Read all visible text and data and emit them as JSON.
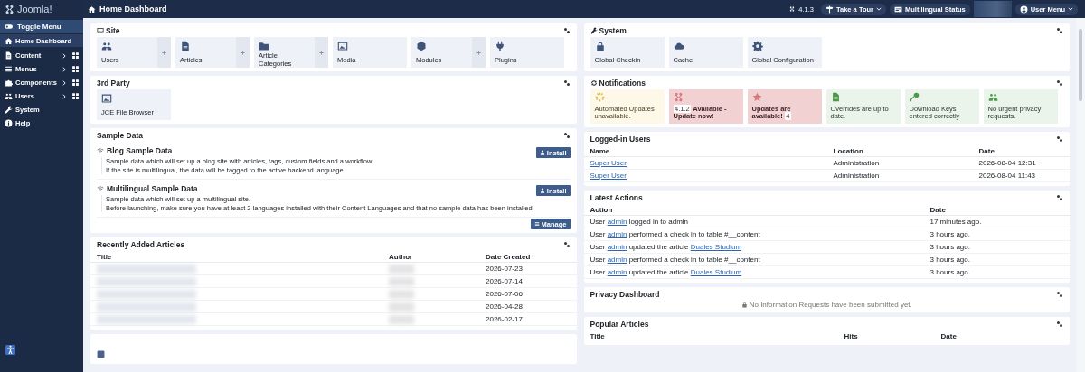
{
  "sidebar": {
    "logo": "Joomla!",
    "toggle": {
      "label": "Toggle Menu"
    },
    "items": [
      {
        "label": "Home Dashboard",
        "selected": true,
        "expandable": false
      },
      {
        "label": "Content",
        "selected": false,
        "expandable": true
      },
      {
        "label": "Menus",
        "selected": false,
        "expandable": true
      },
      {
        "label": "Components",
        "selected": false,
        "expandable": true
      },
      {
        "label": "Users",
        "selected": false,
        "expandable": true
      },
      {
        "label": "System",
        "selected": false,
        "expandable": false
      },
      {
        "label": "Help",
        "selected": false,
        "expandable": false
      }
    ]
  },
  "header": {
    "title": "Home Dashboard",
    "version": "4.1.3",
    "buttons": [
      "Take a Tour",
      "Multilingual Status"
    ],
    "user_menu": "User Menu"
  },
  "left": {
    "site": {
      "title": "Site",
      "tiles": [
        {
          "label": "Users",
          "add": true
        },
        {
          "label": "Articles",
          "add": true
        },
        {
          "label": "Article Categories",
          "add": true
        },
        {
          "label": "Media",
          "add": false
        },
        {
          "label": "Modules",
          "add": true
        },
        {
          "label": "Plugins",
          "add": false
        }
      ]
    },
    "third_party": {
      "title": "3rd Party",
      "tiles": [
        {
          "label": "JCE File Browser",
          "add": false
        }
      ]
    },
    "sample_data": {
      "title": "Sample Data",
      "items": [
        {
          "title": "Blog Sample Data",
          "lines": [
            "Sample data which will set up a blog site with articles, tags, custom fields and a workflow.",
            "If the site is multilingual, the data will be tagged to the active backend language."
          ],
          "button": "Install"
        },
        {
          "title": "Multilingual Sample Data",
          "lines": [
            "Sample data which will set up a multilingual site.",
            "Before launching, make sure you have at least 2 languages installed with their Content Languages and that no sample data has been installed."
          ],
          "button": "Install"
        }
      ],
      "manage": "Manage"
    },
    "recent_articles": {
      "title": "Recently Added Articles",
      "columns": [
        "Title",
        "Author",
        "Date Created"
      ],
      "rows": [
        "2026-07-23",
        "2026-07-14",
        "2026-07-06",
        "2026-04-28",
        "2026-02-17"
      ]
    }
  },
  "right": {
    "system": {
      "title": "System",
      "tiles": [
        {
          "label": "Global Checkin"
        },
        {
          "label": "Cache"
        },
        {
          "label": "Global Configuration"
        }
      ]
    },
    "notifications": {
      "title": "Notifications",
      "tiles": [
        {
          "kind": "warning",
          "text": "Automated Updates unavailable.",
          "bold": false
        },
        {
          "kind": "danger",
          "badge_before": "4.1.2",
          "text": "Available - Update now!",
          "bold": true
        },
        {
          "kind": "danger",
          "text": "Updates are available!",
          "bold": true,
          "badge_after": "4"
        },
        {
          "kind": "success",
          "text": "Overrides are up to date.",
          "bold": false
        },
        {
          "kind": "success",
          "text": "Download Keys entered correctly",
          "bold": false
        },
        {
          "kind": "success",
          "text": "No urgent privacy requests.",
          "bold": false
        }
      ]
    },
    "logged_in": {
      "title": "Logged-in Users",
      "columns": [
        "Name",
        "Location",
        "Date"
      ],
      "rows": [
        {
          "name": "Super User",
          "location": "Administration",
          "date": "2026-08-04 12:31"
        },
        {
          "name": "Super User",
          "location": "Administration",
          "date": "2026-08-04 11:43"
        }
      ]
    },
    "latest_actions": {
      "title": "Latest Actions",
      "columns": [
        "Action",
        "Date"
      ],
      "rows": [
        {
          "parts": [
            {
              "text": "User "
            },
            {
              "link": "admin"
            },
            {
              "text": " logged in to admin"
            }
          ],
          "date": "17 minutes ago."
        },
        {
          "parts": [
            {
              "text": "User "
            },
            {
              "link": "admin"
            },
            {
              "text": " performed a check in to table #__content"
            }
          ],
          "date": "3 hours ago."
        },
        {
          "parts": [
            {
              "text": "User "
            },
            {
              "link": "admin"
            },
            {
              "text": " updated the article "
            },
            {
              "link": "Duales Studium"
            }
          ],
          "date": "3 hours ago."
        },
        {
          "parts": [
            {
              "text": "User "
            },
            {
              "link": "admin"
            },
            {
              "text": " performed a check in to table #__content"
            }
          ],
          "date": "3 hours ago."
        },
        {
          "parts": [
            {
              "text": "User "
            },
            {
              "link": "admin"
            },
            {
              "text": " updated the article "
            },
            {
              "link": "Duales Studium"
            }
          ],
          "date": "3 hours ago."
        }
      ]
    },
    "privacy": {
      "title": "Privacy Dashboard",
      "message": "No Information Requests have been submitted yet."
    },
    "popular": {
      "title": "Popular Articles",
      "columns": [
        "Title",
        "Hits",
        "Date"
      ]
    }
  }
}
